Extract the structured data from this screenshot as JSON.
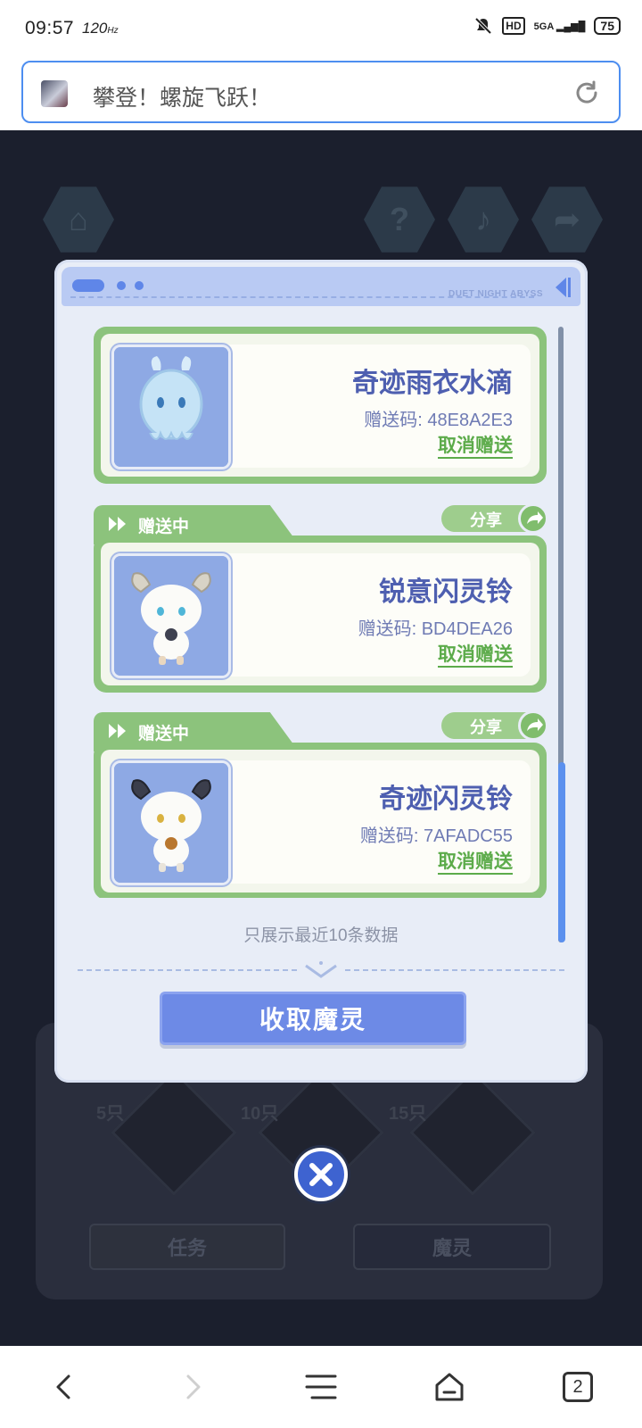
{
  "status_bar": {
    "time": "09:57",
    "refresh_rate": "120",
    "network": "5GA",
    "battery": "75"
  },
  "browser": {
    "page_title": "攀登！螺旋飞跃！",
    "tab_count": "2"
  },
  "background": {
    "tier_tags": [
      "5只",
      "10只",
      "15只"
    ],
    "tabs": [
      "任务",
      "魔灵"
    ]
  },
  "modal": {
    "header_brand": "DUET NIGHT ABYSS",
    "items": [
      {
        "status": "",
        "name": "奇迹雨衣水滴",
        "code": "赠送码: 48E8A2E3",
        "cancel_label": "取消赠送"
      },
      {
        "status": "赠送中",
        "share_label": "分享",
        "name": "锐意闪灵铃",
        "code": "赠送码: BD4DEA26",
        "cancel_label": "取消赠送"
      },
      {
        "status": "赠送中",
        "share_label": "分享",
        "name": "奇迹闪灵铃",
        "code": "赠送码: 7AFADC55",
        "cancel_label": "取消赠送"
      }
    ],
    "note": "只展示最近10条数据",
    "claim_button": "收取魔灵"
  },
  "colors": {
    "accent_blue": "#6d8ae6",
    "card_green": "#8cc37c",
    "name_blue": "#4e5fb0"
  }
}
